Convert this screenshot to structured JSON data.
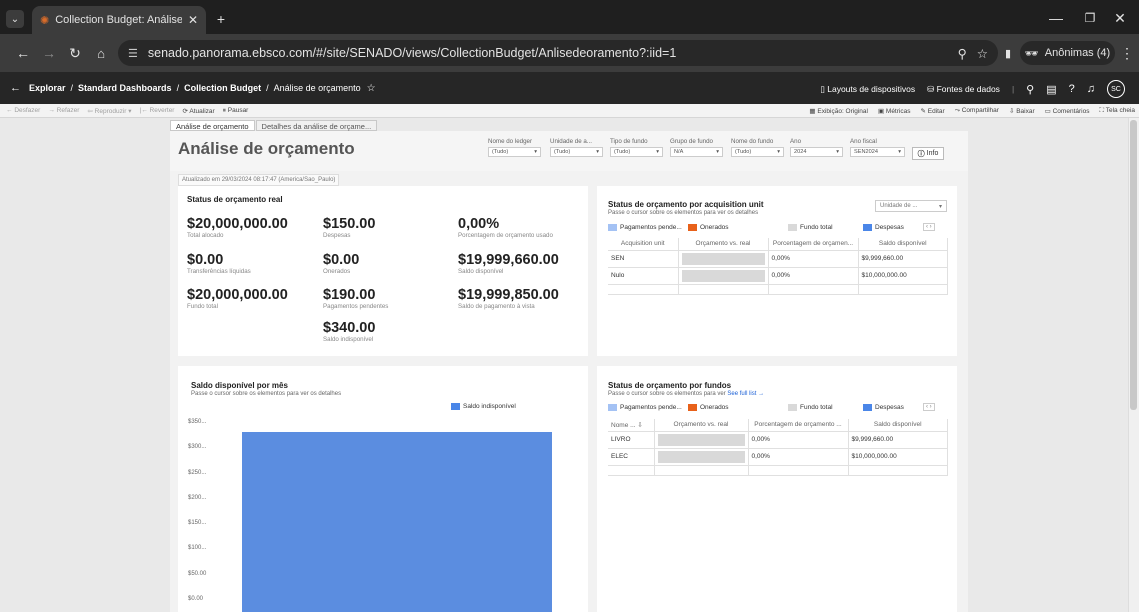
{
  "browser": {
    "tab_title": "Collection Budget: Análise de o",
    "url": "senado.panorama.ebsco.com/#/site/SENADO/views/CollectionBudget/Anlisedeoramento?:iid=1",
    "incognito_label": "Anônimas (4)"
  },
  "app_header": {
    "explorar": "Explorar",
    "standard": "Standard Dashboards",
    "collection": "Collection Budget",
    "current": "Análise de orçamento",
    "layouts": "Layouts de dispositivos",
    "fontes": "Fontes de dados",
    "avatar": "SC"
  },
  "toolbar": {
    "desfazer": "Desfazer",
    "refazer": "Refazer",
    "reproduzir": "Reproduzir",
    "reverter": "Reverter",
    "atualizar": "Atualizar",
    "pausar": "Pausar",
    "exibicao": "Exibição: Original",
    "metricas": "Métricas",
    "editar": "Editar",
    "compartilhar": "Compartilhar",
    "baixar": "Baixar",
    "comentarios": "Comentários",
    "tela_cheia": "Tela cheia"
  },
  "sheet_tabs": [
    "Análise de orçamento",
    "Detalhes da análise de orçame..."
  ],
  "dashboard": {
    "title": "Análise de orçamento",
    "updated": "Atualizado em 29/03/2024 08:17:47 (America/Sao_Paulo)",
    "info": "Info"
  },
  "filters": [
    {
      "label": "Nome do ledger",
      "value": "(Tudo)"
    },
    {
      "label": "Unidade de a...",
      "value": "(Tudo)"
    },
    {
      "label": "Tipo de fundo",
      "value": "(Tudo)"
    },
    {
      "label": "Grupo de fundo",
      "value": "N/A"
    },
    {
      "label": "Nome do fundo",
      "value": "(Tudo)"
    },
    {
      "label": "Ano",
      "value": "2024"
    },
    {
      "label": "Ano fiscal",
      "value": "SEN2024"
    }
  ],
  "status_real": {
    "title": "Status de orçamento real",
    "items": [
      {
        "value": "$20,000,000.00",
        "label": "Total alocado"
      },
      {
        "value": "$150.00",
        "label": "Despesas"
      },
      {
        "value": "0,00%",
        "label": "Porcentagem de orçamento usado"
      },
      {
        "value": "$0.00",
        "label": "Transferências líquidas"
      },
      {
        "value": "$0.00",
        "label": "Onerados"
      },
      {
        "value": "$19,999,660.00",
        "label": "Saldo disponível"
      },
      {
        "value": "$20,000,000.00",
        "label": "Fundo total"
      },
      {
        "value": "$190.00",
        "label": "Pagamentos pendentes"
      },
      {
        "value": "$19,999,850.00",
        "label": "Saldo de pagamento à vista"
      },
      {
        "value": "$340.00",
        "label": "Saldo indisponível"
      }
    ]
  },
  "acq": {
    "title": "Status de orçamento por acquisition unit",
    "subtitle": "Passe o cursor sobre os elementos para ver os detalhes",
    "dropdown": "Unidade de ...",
    "legend": [
      "Pagamentos pende...",
      "Onerados",
      "Fundo total",
      "Despesas"
    ],
    "headers": [
      "Acquisition unit",
      "Orçamento vs. real",
      "Porcentagem de orçamen...",
      "Saldo disponível"
    ],
    "rows": [
      {
        "name": "SEN",
        "pct": "0,00%",
        "saldo": "$9,999,660.00"
      },
      {
        "name": "Nulo",
        "pct": "0,00%",
        "saldo": "$10,000,000.00"
      }
    ]
  },
  "monthly": {
    "title": "Saldo disponível por mês",
    "subtitle": "Passe o cursor sobre os elementos para ver os detalhes",
    "legend": "Saldo indisponível",
    "ticks": [
      "$350...",
      "$300...",
      "$250...",
      "$200...",
      "$150...",
      "$100...",
      "$50.00",
      "$0.00"
    ]
  },
  "fundos": {
    "title": "Status de orçamento por fundos",
    "subtitle": "Passe o cursor sobre os elementos para ver",
    "link": "See full list →",
    "legend": [
      "Pagamentos pende...",
      "Onerados",
      "Fundo total",
      "Despesas"
    ],
    "headers": [
      "Nome ...",
      "Orçamento vs. real",
      "Porcentagem de orçamento ...",
      "Saldo disponível"
    ],
    "rows": [
      {
        "name": "LIVRO",
        "pct": "0,00%",
        "saldo": "$9,999,660.00"
      },
      {
        "name": "ELEC",
        "pct": "0,00%",
        "saldo": "$10,000,000.00"
      }
    ]
  },
  "colors": {
    "light_blue": "#a4c2f4",
    "orange": "#e8611a",
    "gray": "#d9d9d9",
    "blue": "#4a86e8",
    "bar": "#5b8de0"
  },
  "chart_data": {
    "type": "bar",
    "title": "Saldo disponível por mês",
    "series": [
      {
        "name": "Saldo indisponível",
        "values": [
          340
        ]
      }
    ],
    "categories": [
      ""
    ],
    "ylim": [
      0,
      350
    ]
  }
}
